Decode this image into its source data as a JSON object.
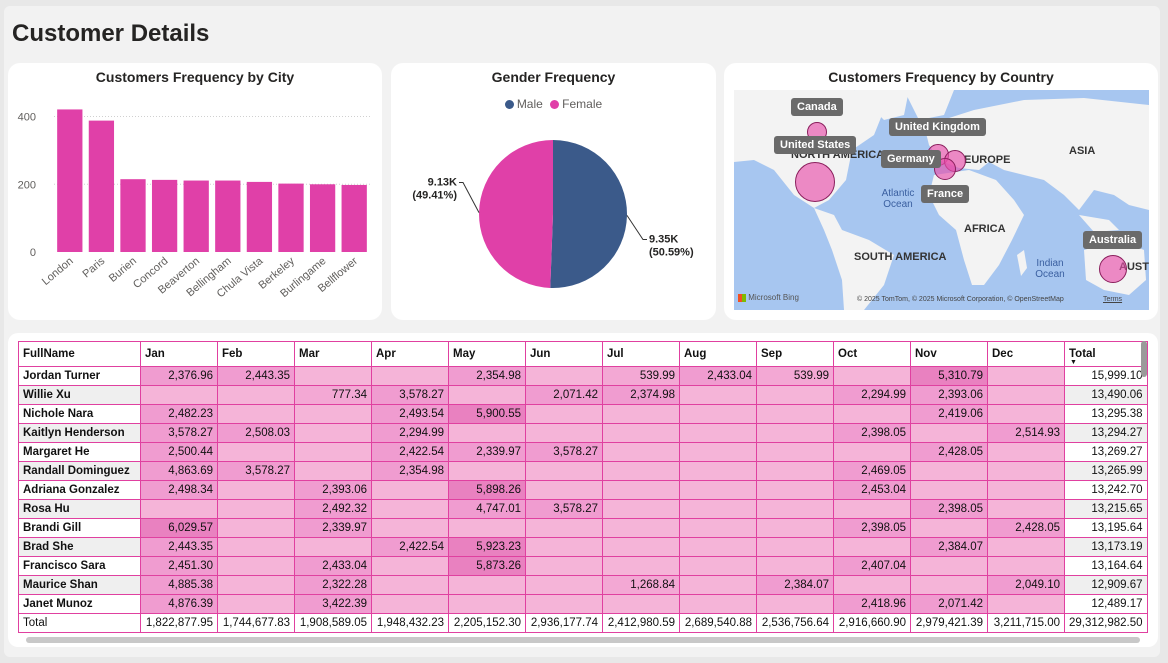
{
  "page_title": "Customer Details",
  "city_chart": {
    "title": "Customers Frequency by City",
    "chart_data": {
      "type": "bar",
      "title": "Customers Frequency by City",
      "categories": [
        "London",
        "Paris",
        "Burien",
        "Concord",
        "Beaverton",
        "Bellingham",
        "Chula Vista",
        "Berkeley",
        "Burlingame",
        "Bellflower"
      ],
      "values": [
        421,
        388,
        215,
        213,
        211,
        211,
        207,
        202,
        200,
        198
      ],
      "yticks": [
        "400",
        "200",
        "0"
      ],
      "ylim": [
        0,
        440
      ],
      "color": "#e040a8"
    }
  },
  "gender_chart": {
    "title": "Gender Frequency",
    "legend": [
      {
        "label": "Male",
        "color": "#3b5a8a"
      },
      {
        "label": "Female",
        "color": "#e040a8"
      }
    ],
    "chart_data": {
      "type": "pie",
      "title": "Gender Frequency",
      "slices": [
        {
          "name": "Male",
          "value": 9350,
          "pct": 50.59,
          "label": "9.35K",
          "pct_label": "(50.59%)",
          "color": "#3b5a8a"
        },
        {
          "name": "Female",
          "value": 9130,
          "pct": 49.41,
          "label": "9.13K",
          "pct_label": "(49.41%)",
          "color": "#e040a8"
        }
      ]
    }
  },
  "country_map": {
    "title": "Customers Frequency by Country",
    "labels": {
      "canada": "Canada",
      "us": "United States",
      "uk": "United Kingdom",
      "germany": "Germany",
      "france": "France",
      "australia": "Australia"
    },
    "regions": {
      "na": "NORTH AMERICA",
      "europe": "EUROPE",
      "asia": "ASIA",
      "africa": "AFRICA",
      "sa": "SOUTH AMERICA",
      "austra": "AUSTRA"
    },
    "oceans": {
      "atlantic": "Atlantic Ocean",
      "indian": "Indian Ocean"
    },
    "bing": "Microsoft Bing",
    "copyright": "© 2025 TomTom, © 2025 Microsoft Corporation, © OpenStreetMap",
    "terms": "Terms"
  },
  "matrix": {
    "columns": [
      "FullName",
      "Jan",
      "Feb",
      "Mar",
      "Apr",
      "May",
      "Jun",
      "Jul",
      "Aug",
      "Sep",
      "Oct",
      "Nov",
      "Dec",
      "Total"
    ],
    "rows": [
      {
        "name": "Jordan Turner",
        "v": [
          "2,376.96",
          "2,443.35",
          "",
          "",
          "2,354.98",
          "",
          "539.99",
          "2,433.04",
          "539.99",
          "",
          "5,310.79",
          ""
        ],
        "total": "15,999.10"
      },
      {
        "name": "Willie Xu",
        "v": [
          "",
          "",
          "777.34",
          "3,578.27",
          "",
          "2,071.42",
          "2,374.98",
          "",
          "",
          "2,294.99",
          "2,393.06",
          ""
        ],
        "total": "13,490.06"
      },
      {
        "name": "Nichole Nara",
        "v": [
          "2,482.23",
          "",
          "",
          "2,493.54",
          "5,900.55",
          "",
          "",
          "",
          "",
          "",
          "2,419.06",
          ""
        ],
        "total": "13,295.38"
      },
      {
        "name": "Kaitlyn Henderson",
        "v": [
          "3,578.27",
          "2,508.03",
          "",
          "2,294.99",
          "",
          "",
          "",
          "",
          "",
          "2,398.05",
          "",
          "2,514.93"
        ],
        "total": "13,294.27"
      },
      {
        "name": "Margaret He",
        "v": [
          "2,500.44",
          "",
          "",
          "2,422.54",
          "2,339.97",
          "3,578.27",
          "",
          "",
          "",
          "",
          "2,428.05",
          ""
        ],
        "total": "13,269.27"
      },
      {
        "name": "Randall Dominguez",
        "v": [
          "4,863.69",
          "3,578.27",
          "",
          "2,354.98",
          "",
          "",
          "",
          "",
          "",
          "2,469.05",
          "",
          ""
        ],
        "total": "13,265.99"
      },
      {
        "name": "Adriana Gonzalez",
        "v": [
          "2,498.34",
          "",
          "2,393.06",
          "",
          "5,898.26",
          "",
          "",
          "",
          "",
          "2,453.04",
          "",
          ""
        ],
        "total": "13,242.70"
      },
      {
        "name": "Rosa Hu",
        "v": [
          "",
          "",
          "2,492.32",
          "",
          "4,747.01",
          "3,578.27",
          "",
          "",
          "",
          "",
          "2,398.05",
          ""
        ],
        "total": "13,215.65"
      },
      {
        "name": "Brandi Gill",
        "v": [
          "6,029.57",
          "",
          "2,339.97",
          "",
          "",
          "",
          "",
          "",
          "",
          "2,398.05",
          "",
          "2,428.05"
        ],
        "total": "13,195.64"
      },
      {
        "name": "Brad She",
        "v": [
          "2,443.35",
          "",
          "",
          "2,422.54",
          "5,923.23",
          "",
          "",
          "",
          "",
          "",
          "2,384.07",
          ""
        ],
        "total": "13,173.19"
      },
      {
        "name": "Francisco Sara",
        "v": [
          "2,451.30",
          "",
          "2,433.04",
          "",
          "5,873.26",
          "",
          "",
          "",
          "",
          "2,407.04",
          "",
          ""
        ],
        "total": "13,164.64"
      },
      {
        "name": "Maurice Shan",
        "v": [
          "4,885.38",
          "",
          "2,322.28",
          "",
          "",
          "",
          "1,268.84",
          "",
          "2,384.07",
          "",
          "",
          "2,049.10"
        ],
        "total": "12,909.67"
      },
      {
        "name": "Janet Munoz",
        "v": [
          "4,876.39",
          "",
          "3,422.39",
          "",
          "",
          "",
          "",
          "",
          "",
          "2,418.96",
          "2,071.42",
          ""
        ],
        "total": "12,489.17"
      }
    ],
    "total_row": {
      "label": "Total",
      "v": [
        "1,822,877.95",
        "1,744,677.83",
        "1,908,589.05",
        "1,948,432.23",
        "2,205,152.30",
        "2,936,177.74",
        "2,412,980.59",
        "2,689,540.88",
        "2,536,756.64",
        "2,916,660.90",
        "2,979,421.39",
        "3,211,715.00"
      ],
      "total": "29,312,982.50"
    }
  }
}
